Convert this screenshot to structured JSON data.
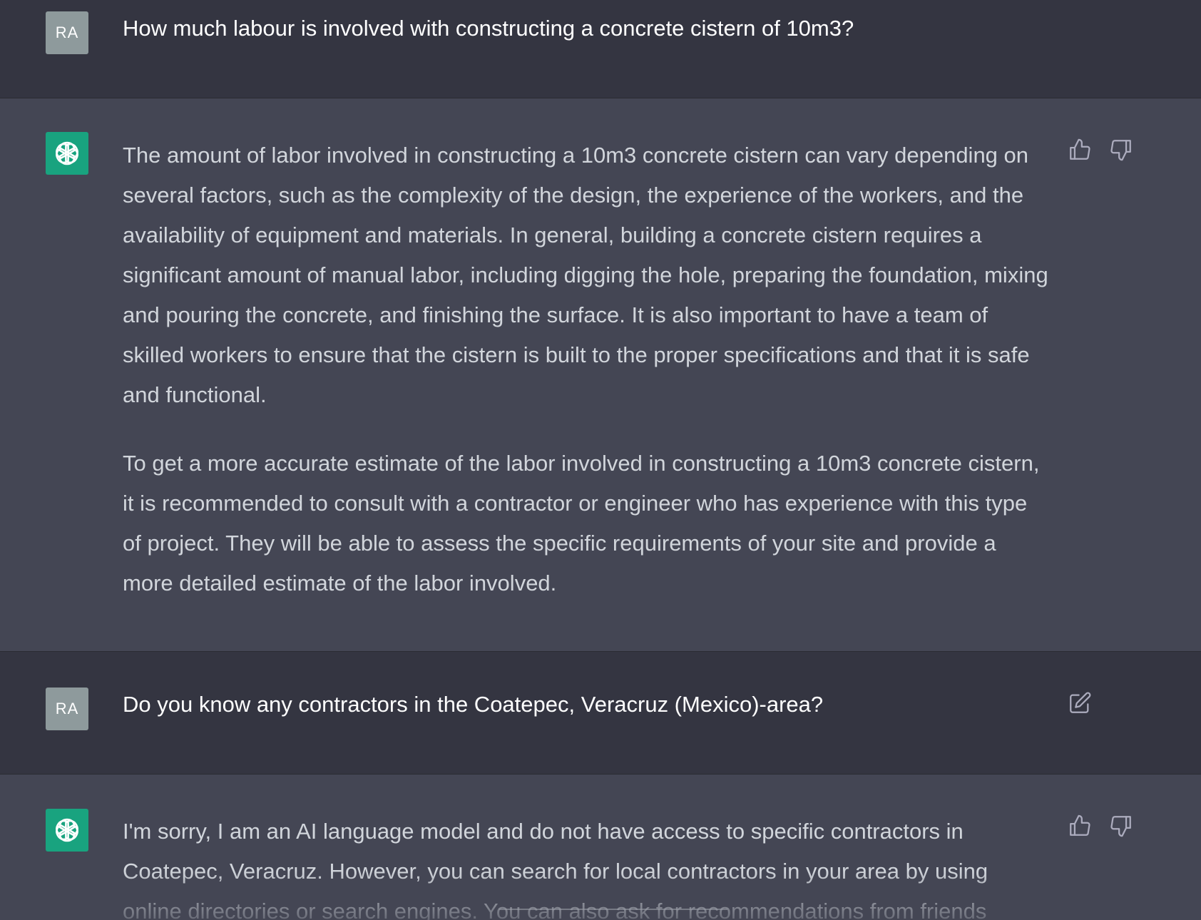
{
  "messages": [
    {
      "role": "user",
      "avatar": "RA",
      "text": "How much labour is involved with constructing a concrete cistern of 10m3?"
    },
    {
      "role": "assistant",
      "avatar_icon": "openai-logo-icon",
      "paragraphs": [
        "The amount of labor involved in constructing a 10m3 concrete cistern can vary depending on several factors, such as the complexity of the design, the experience of the workers, and the availability of equipment and materials. In general, building a concrete cistern requires a significant amount of manual labor, including digging the hole, preparing the foundation, mixing and pouring the concrete, and finishing the surface. It is also important to have a team of skilled workers to ensure that the cistern is built to the proper specifications and that it is safe and functional.",
        "To get a more accurate estimate of the labor involved in constructing a 10m3 concrete cistern, it is recommended to consult with a contractor or engineer who has experience with this type of project. They will be able to assess the specific requirements of your site and provide a more detailed estimate of the labor involved."
      ]
    },
    {
      "role": "user",
      "avatar": "RA",
      "text": "Do you know any contractors in the Coatepec, Veracruz (Mexico)-area?"
    },
    {
      "role": "assistant",
      "avatar_icon": "openai-logo-icon",
      "paragraphs": [
        "I'm sorry, I am an AI language model and do not have access to specific contractors in Coatepec, Veracruz. However, you can search for local contractors in your area by using online directories or search engines. You can also ask for recommendations from friends"
      ]
    }
  ],
  "colors": {
    "user_bg": "#343541",
    "assistant_bg": "#444654",
    "user_avatar": "#8e9a9c",
    "bot_avatar": "#19a37f",
    "icon": "#acacbe"
  }
}
